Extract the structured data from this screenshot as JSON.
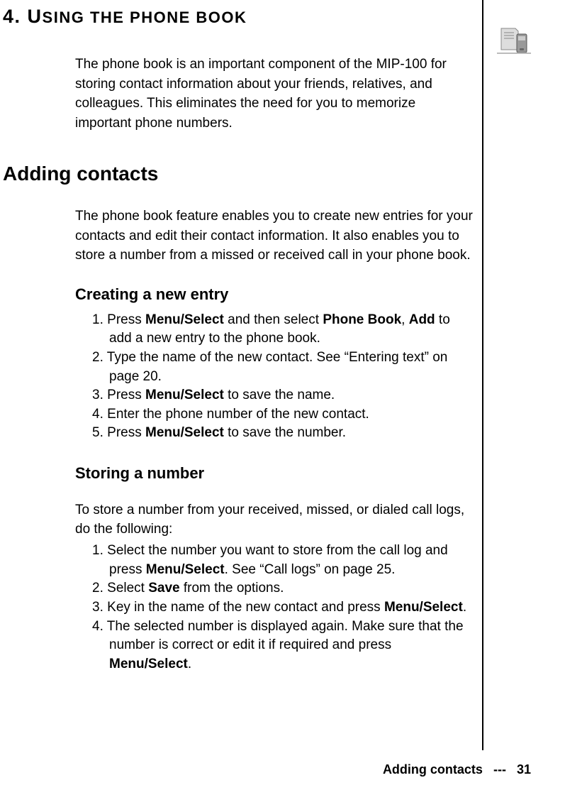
{
  "chapter": {
    "number": "4.",
    "title_prefix": "U",
    "title_rest": "SING THE PHONE BOOK"
  },
  "intro": "The phone book is an important component of the MIP-100 for storing contact information about your friends, relatives, and colleagues. This eliminates the need for you to memorize important phone numbers.",
  "section": {
    "heading": "Adding contacts",
    "para": "The phone book feature enables you to create new entries for your contacts and edit their contact information. It also enables you to store a number from a missed or received call in your phone book."
  },
  "subsection1": {
    "heading": "Creating a new entry",
    "items": [
      {
        "num": "1.",
        "pre": "Press ",
        "b1": "Menu/Select",
        "mid1": " and then select ",
        "b2": "Phone Book",
        "mid2": ", ",
        "b3": "Add",
        "post": " to add a new entry to the phone book."
      },
      {
        "num": "2.",
        "text": "Type the name of the new contact. See “Entering text” on page 20."
      },
      {
        "num": "3.",
        "pre": "Press ",
        "b1": "Menu/Select",
        "post": " to save the name."
      },
      {
        "num": "4.",
        "text": "Enter the phone number of the new contact."
      },
      {
        "num": "5.",
        "pre": "Press ",
        "b1": "Menu/Select",
        "post": " to save the number."
      }
    ]
  },
  "subsection2": {
    "heading": "Storing a number",
    "para": "To store a number from your received, missed, or dialed call logs, do the following:",
    "items": [
      {
        "num": "1.",
        "pre": "Select the number you want to store from the call log and press ",
        "b1": "Menu/Select",
        "post": ". See “Call logs” on page 25."
      },
      {
        "num": "2.",
        "pre": "Select ",
        "b1": "Save",
        "post": " from the options."
      },
      {
        "num": "3.",
        "pre": "Key in the name of the new contact and press ",
        "b1": "Menu/Select",
        "post": "."
      },
      {
        "num": "4.",
        "pre": "The selected number is displayed again. Make sure that the number is correct or edit it if required and press ",
        "b1": "Menu/Select",
        "post": "."
      }
    ]
  },
  "footer": {
    "label": "Adding contacts",
    "separator": "---",
    "page": "31"
  }
}
